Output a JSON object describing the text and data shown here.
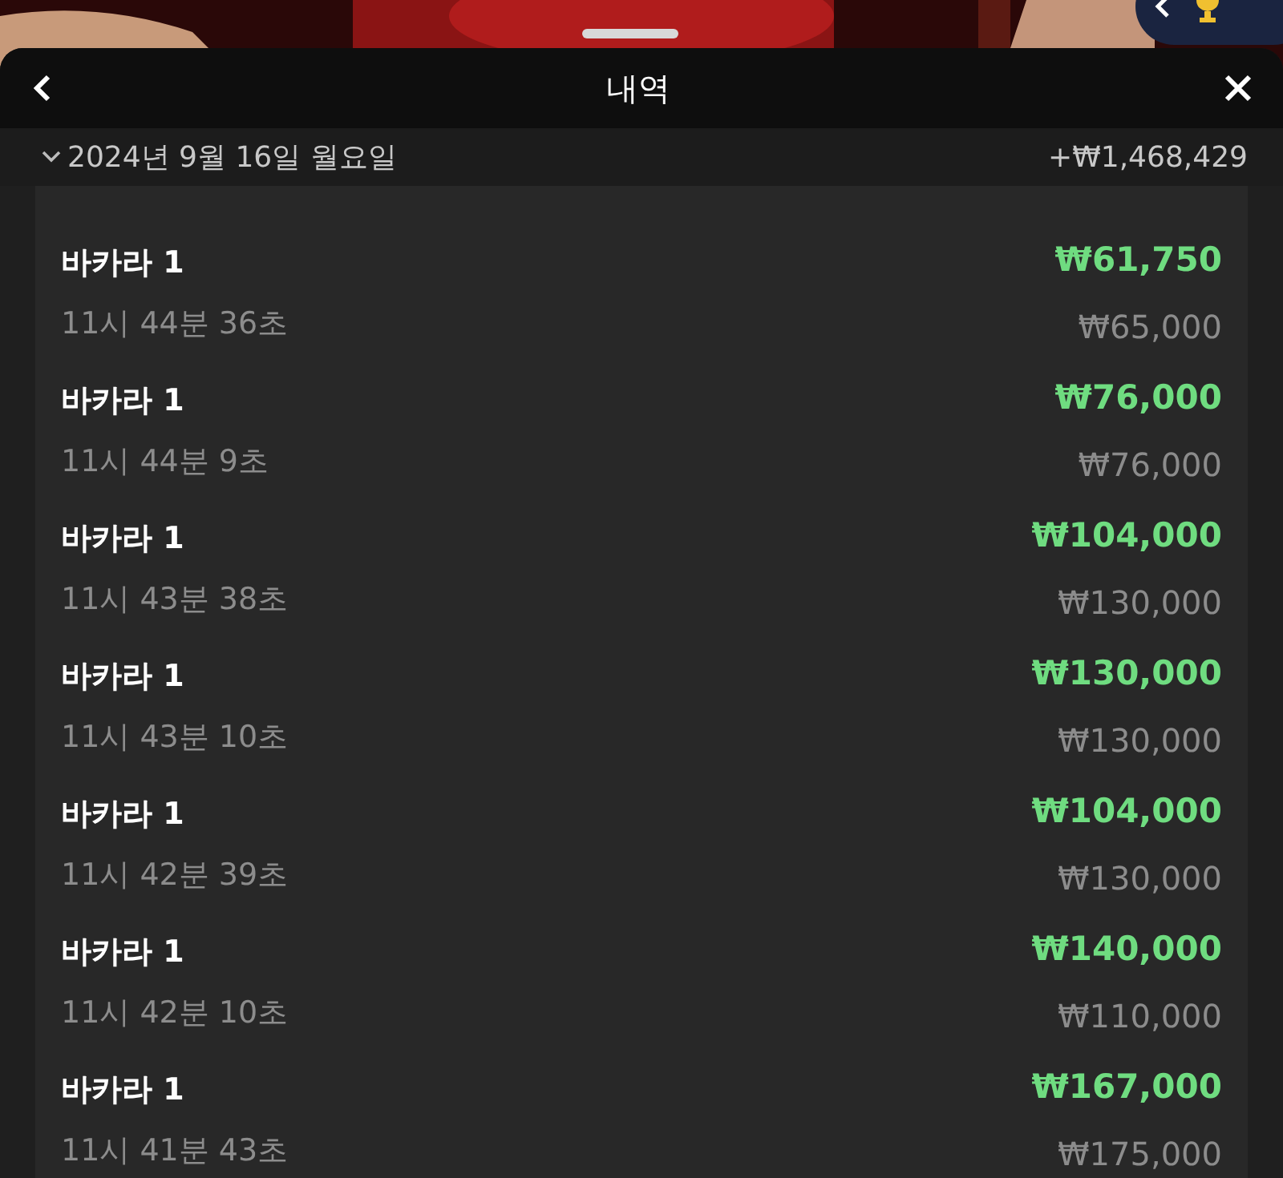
{
  "header": {
    "title": "내역"
  },
  "day": {
    "date": "2024년 9월 16일 월요일",
    "total": "+₩1,468,429",
    "expanded": true
  },
  "rows": [
    {
      "game": "바카라 1",
      "time": "11시 44분 36초",
      "payout": "₩61,750",
      "bet": "₩65,000"
    },
    {
      "game": "바카라 1",
      "time": "11시 44분 9초",
      "payout": "₩76,000",
      "bet": "₩76,000"
    },
    {
      "game": "바카라 1",
      "time": "11시 43분 38초",
      "payout": "₩104,000",
      "bet": "₩130,000"
    },
    {
      "game": "바카라 1",
      "time": "11시 43분 10초",
      "payout": "₩130,000",
      "bet": "₩130,000"
    },
    {
      "game": "바카라 1",
      "time": "11시 42분 39초",
      "payout": "₩104,000",
      "bet": "₩130,000"
    },
    {
      "game": "바카라 1",
      "time": "11시 42분 10초",
      "payout": "₩140,000",
      "bet": "₩110,000"
    },
    {
      "game": "바카라 1",
      "time": "11시 41분 43초",
      "payout": "₩167,000",
      "bet": "₩175,000"
    }
  ]
}
